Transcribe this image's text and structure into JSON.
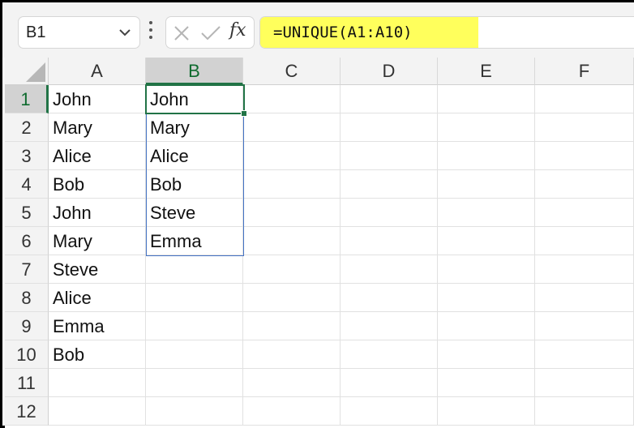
{
  "name_box": {
    "value": "B1"
  },
  "formula_bar": {
    "formula": "=UNIQUE(A1:A10)",
    "fx_label": "fx"
  },
  "columns": [
    "A",
    "B",
    "C",
    "D",
    "E",
    "F"
  ],
  "selected_column": "B",
  "rows": [
    "1",
    "2",
    "3",
    "4",
    "5",
    "6",
    "7",
    "8",
    "9",
    "10",
    "11",
    "12"
  ],
  "selected_row": "1",
  "column_a": [
    "John",
    "Mary",
    "Alice",
    "Bob",
    "John",
    "Mary",
    "Steve",
    "Alice",
    "Emma",
    "Bob",
    "",
    ""
  ],
  "column_b": [
    "John",
    "Mary",
    "Alice",
    "Bob",
    "Steve",
    "Emma",
    "",
    "",
    "",
    "",
    "",
    ""
  ],
  "colors": {
    "accent": "#217346",
    "highlight": "#ffff5c",
    "spill_border": "#4472c4"
  }
}
